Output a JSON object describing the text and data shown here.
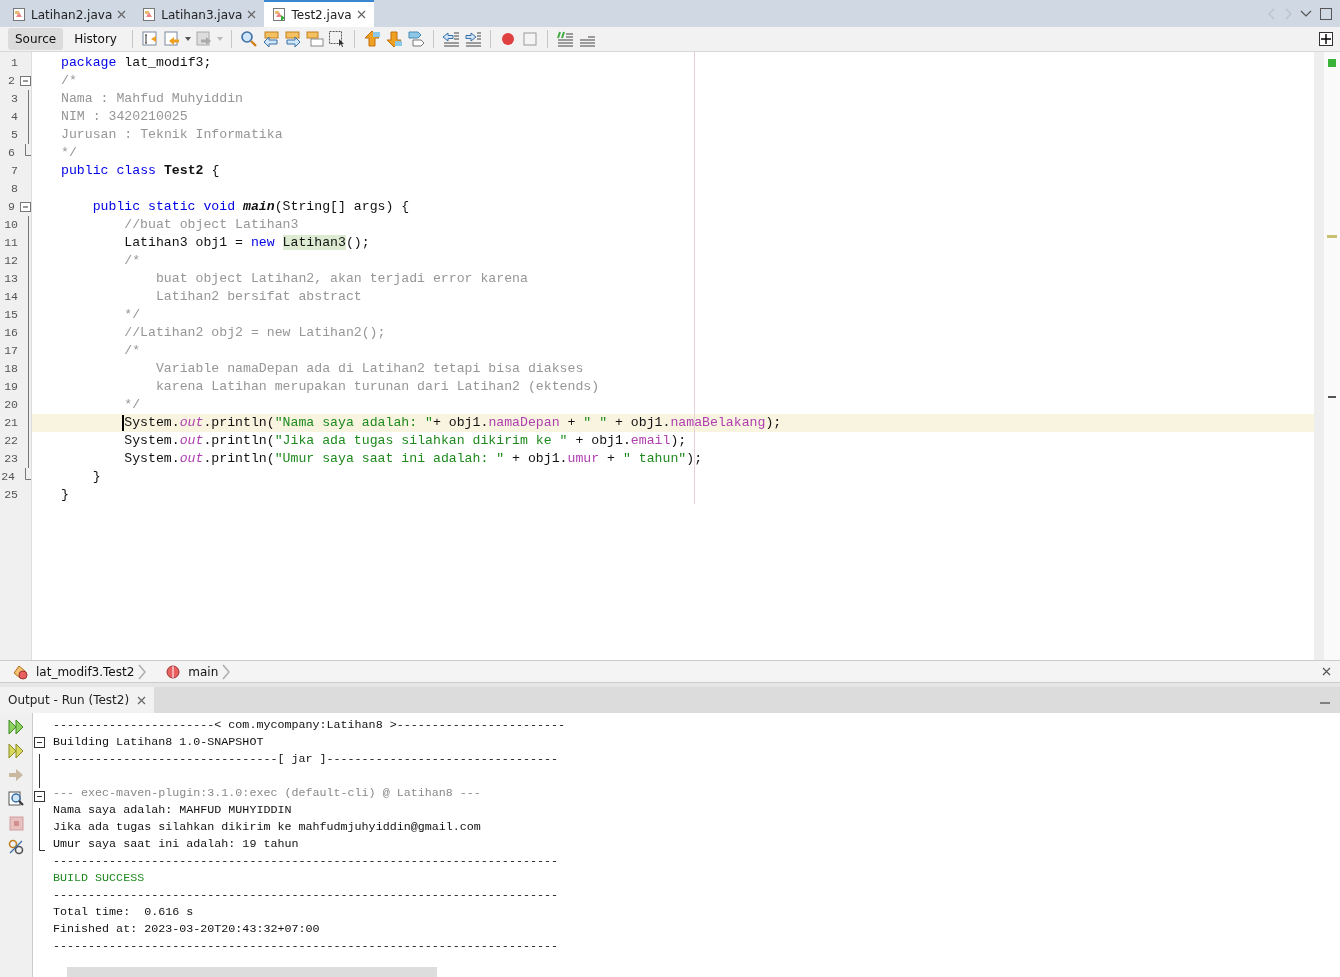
{
  "editor_tabs": [
    {
      "label": "Latihan2.java",
      "selected": false
    },
    {
      "label": "Latihan3.java",
      "selected": false
    },
    {
      "label": "Test2.java",
      "selected": true
    }
  ],
  "view_buttons": [
    {
      "label": "Source",
      "selected": true
    },
    {
      "label": "History",
      "selected": false
    }
  ],
  "code_lines": [
    {
      "number": "1",
      "current": false,
      "tokens": [
        {
          "kind": "kw",
          "text": "package"
        },
        {
          "kind": "plain",
          "text": " lat_modif3;"
        }
      ]
    },
    {
      "number": "2",
      "current": false,
      "fold_start": true,
      "tokens": [
        {
          "kind": "comment",
          "text": "/*"
        }
      ]
    },
    {
      "number": "3",
      "current": false,
      "tokens": [
        {
          "kind": "comment",
          "text": "Nama : Mahfud Muhyiddin"
        }
      ]
    },
    {
      "number": "4",
      "current": false,
      "tokens": [
        {
          "kind": "comment",
          "text": "NIM : 3420210025"
        }
      ]
    },
    {
      "number": "5",
      "current": false,
      "tokens": [
        {
          "kind": "comment",
          "text": "Jurusan : Teknik Informatika"
        }
      ]
    },
    {
      "number": "6",
      "current": false,
      "fold_end": true,
      "tokens": [
        {
          "kind": "comment",
          "text": "*/"
        }
      ]
    },
    {
      "number": "7",
      "current": false,
      "tokens": [
        {
          "kind": "kw",
          "text": "public class "
        },
        {
          "kind": "decl",
          "text": "Test2"
        },
        {
          "kind": "plain",
          "text": " {"
        }
      ],
      "children": [
        {
          "number": "8",
          "current": false
        },
        {
          "number": "9",
          "current": false,
          "fold_start": true,
          "tokens": [
            {
              "kind": "kw",
              "text": "public static void "
            },
            {
              "kind": "method",
              "text": "main"
            },
            {
              "kind": "plain",
              "text": "(String[] args) {"
            }
          ],
          "children": [
            {
              "number": "10",
              "current": false,
              "tokens": [
                {
                  "kind": "comment",
                  "text": "//buat object Latihan3"
                }
              ]
            },
            {
              "number": "11",
              "current": false,
              "tokens": [
                {
                  "kind": "plain",
                  "text": "Latihan3 obj1 = "
                },
                {
                  "kind": "kw",
                  "text": "new "
                },
                {
                  "kind": "mark",
                  "text": "Latihan3"
                },
                {
                  "kind": "plain",
                  "text": "();"
                }
              ]
            },
            {
              "number": "12",
              "current": false,
              "tokens": [
                {
                  "kind": "comment",
                  "text": "/*"
                }
              ],
              "children": [
                {
                  "number": "13",
                  "current": false,
                  "tokens": [
                    {
                      "kind": "comment",
                      "text": "buat object Latihan2, akan terjadi error karena"
                    }
                  ]
                },
                {
                  "number": "14",
                  "current": false,
                  "tokens": [
                    {
                      "kind": "comment",
                      "text": "Latihan2 bersifat abstract"
                    }
                  ]
                }
              ]
            },
            {
              "number": "15",
              "current": false,
              "tokens": [
                {
                  "kind": "comment",
                  "text": "*/"
                }
              ]
            },
            {
              "number": "16",
              "current": false,
              "tokens": [
                {
                  "kind": "comment",
                  "text": "//Latihan2 obj2 = new Latihan2();"
                }
              ]
            },
            {
              "number": "17",
              "current": false,
              "tokens": [
                {
                  "kind": "comment",
                  "text": "/*"
                }
              ],
              "children": [
                {
                  "number": "18",
                  "current": false,
                  "tokens": [
                    {
                      "kind": "comment",
                      "text": "Variable namaDepan ada di Latihan2 tetapi bisa diakses"
                    }
                  ]
                },
                {
                  "number": "19",
                  "current": false,
                  "tokens": [
                    {
                      "kind": "comment",
                      "text": "karena Latihan merupakan turunan dari Latihan2 (ektends)"
                    }
                  ]
                }
              ]
            },
            {
              "number": "20",
              "current": false,
              "tokens": [
                {
                  "kind": "comment",
                  "text": "*/"
                }
              ]
            },
            {
              "number": "21",
              "current": true,
              "tokens": [
                {
                  "kind": "plain",
                  "text": "System."
                },
                {
                  "kind": "static",
                  "text": "out"
                },
                {
                  "kind": "plain",
                  "text": ".println("
                },
                {
                  "kind": "string",
                  "text": "\"Nama saya adalah: \""
                },
                {
                  "kind": "plain",
                  "text": "+ obj1."
                },
                {
                  "kind": "field",
                  "text": "namaDepan"
                },
                {
                  "kind": "plain",
                  "text": " + "
                },
                {
                  "kind": "string",
                  "text": "\" \""
                },
                {
                  "kind": "plain",
                  "text": " + obj1."
                },
                {
                  "kind": "field",
                  "text": "namaBelakang"
                },
                {
                  "kind": "plain",
                  "text": ");"
                }
              ]
            },
            {
              "number": "22",
              "current": false,
              "tokens": [
                {
                  "kind": "plain",
                  "text": "System."
                },
                {
                  "kind": "static",
                  "text": "out"
                },
                {
                  "kind": "plain",
                  "text": ".println("
                },
                {
                  "kind": "string",
                  "text": "\"Jika ada tugas silahkan dikirim ke \""
                },
                {
                  "kind": "plain",
                  "text": " + obj1."
                },
                {
                  "kind": "field",
                  "text": "email"
                },
                {
                  "kind": "plain",
                  "text": ");"
                }
              ]
            },
            {
              "number": "23",
              "current": false,
              "tokens": [
                {
                  "kind": "plain",
                  "text": "System."
                },
                {
                  "kind": "static",
                  "text": "out"
                },
                {
                  "kind": "plain",
                  "text": ".println("
                },
                {
                  "kind": "string",
                  "text": "\"Umur saya saat ini adalah: \""
                },
                {
                  "kind": "plain",
                  "text": " + obj1."
                },
                {
                  "kind": "field",
                  "text": "umur"
                },
                {
                  "kind": "plain",
                  "text": " + "
                },
                {
                  "kind": "string",
                  "text": "\" tahun\""
                },
                {
                  "kind": "plain",
                  "text": ");"
                }
              ]
            }
          ]
        },
        {
          "number": "24",
          "current": false,
          "fold_end": true,
          "tokens": [
            {
              "kind": "plain",
              "text": "}"
            }
          ]
        }
      ]
    },
    {
      "number": "25",
      "current": false,
      "tokens": [
        {
          "kind": "plain",
          "text": "}"
        }
      ]
    }
  ],
  "breadcrumbs": [
    {
      "kind": "class",
      "label": "lat_modif3.Test2"
    },
    {
      "kind": "method",
      "label": "main"
    }
  ],
  "output_tab": {
    "label": "Output - Run (Test2)",
    "selected": true
  },
  "output_lines": [
    {
      "kind": "plain",
      "text": "-----------------------< com.mycompany:Latihan8 >------------------------"
    },
    {
      "kind": "plain",
      "fold_start": true,
      "text": "Building Latihan8 1.0-SNAPSHOT"
    },
    {
      "kind": "plain",
      "text": "--------------------------------[ jar ]---------------------------------"
    },
    {
      "kind": "blank"
    },
    {
      "kind": "info",
      "fold_start": true,
      "text": "--- exec-maven-plugin:3.1.0:exec (default-cli) @ Latihan8 ---"
    },
    {
      "kind": "plain",
      "text": "Nama saya adalah: MAHFUD MUHYIDDIN"
    },
    {
      "kind": "plain",
      "text": "Jika ada tugas silahkan dikirim ke mahfudmjuhyiddin@gmail.com"
    },
    {
      "kind": "plain",
      "fold_end": true,
      "text": "Umur saya saat ini adalah: 19 tahun"
    },
    {
      "kind": "plain",
      "text": "------------------------------------------------------------------------"
    },
    {
      "kind": "success",
      "text": "BUILD SUCCESS"
    },
    {
      "kind": "plain",
      "text": "------------------------------------------------------------------------"
    },
    {
      "kind": "plain",
      "text": "Total time:  0.616 s"
    },
    {
      "kind": "plain",
      "text": "Finished at: 2023-03-20T20:43:32+07:00"
    },
    {
      "kind": "plain",
      "text": "------------------------------------------------------------------------"
    }
  ]
}
